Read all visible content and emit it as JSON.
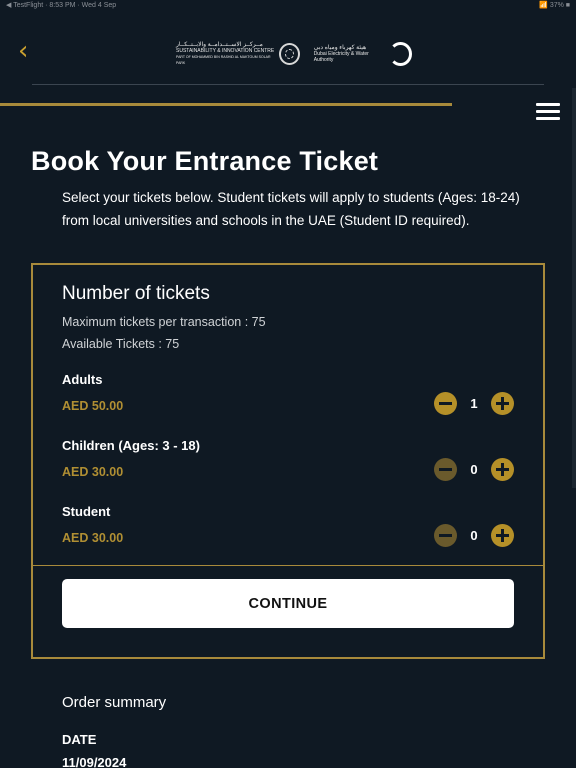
{
  "status_bar": {
    "left": "◀ TestFlight · 8:53 PM · Wed 4 Sep",
    "right": "📶 37% ■"
  },
  "header": {
    "back_icon": "chevron-left-icon",
    "logo1_ar": "مــركــز الاســتــدامــة والابــتــكــار",
    "logo1_en": "SUSTAINABILITY & INNOVATION CENTRE",
    "logo1_sub": "PART OF MOHAMMED BIN RASHID AL MAKTOUM SOLAR PARK",
    "logo2_ar": "هيئة كهرباء ومياه دبي",
    "logo2_en": "Dubai Electricity & Water Authority",
    "menu_icon": "hamburger-menu-icon"
  },
  "page": {
    "title": "Book Your Entrance Ticket",
    "intro": "Select your tickets below. Student tickets will apply to students (Ages: 18-24) from local universities and schools in the UAE (Student ID required)."
  },
  "tickets": {
    "title": "Number of tickets",
    "max_per_transaction": "Maximum tickets per transaction : 75",
    "available": "Available Tickets : 75",
    "rows": [
      {
        "name": "Adults",
        "price": "AED 50.00",
        "qty": "1"
      },
      {
        "name": "Children (Ages: 3 - 18)",
        "price": "AED 30.00",
        "qty": "0"
      },
      {
        "name": "Student",
        "price": "AED 30.00",
        "qty": "0"
      }
    ],
    "continue_label": "CONTINUE"
  },
  "summary": {
    "title": "Order summary",
    "date_label": "DATE",
    "date_value": "11/09/2024"
  },
  "colors": {
    "background": "#0f1923",
    "accent_gold": "#b59028",
    "card_border": "#a88a3b"
  }
}
